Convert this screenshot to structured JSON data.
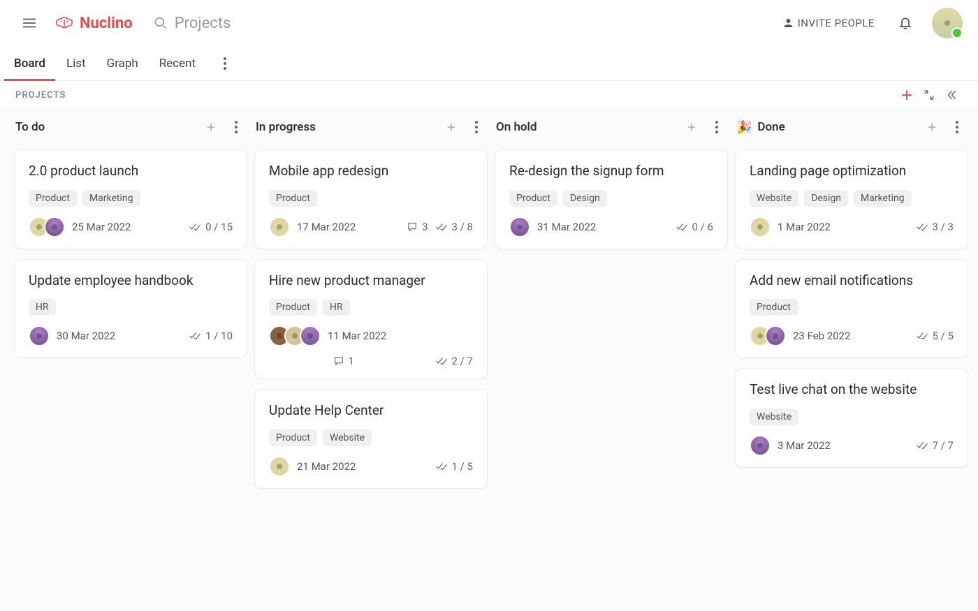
{
  "app": {
    "name": "Nuclino",
    "search_placeholder": "Projects",
    "invite_label": "INVITE PEOPLE"
  },
  "view_tabs": [
    "Board",
    "List",
    "Graph",
    "Recent"
  ],
  "active_view_tab": "Board",
  "board": {
    "title": "PROJECTS"
  },
  "columns": [
    {
      "title": "To do",
      "emoji": "",
      "cards": [
        {
          "title": "2.0 product launch",
          "tags": [
            "Product",
            "Marketing"
          ],
          "avatars": [
            "av-1",
            "av-2"
          ],
          "date": "25 Mar 2022",
          "comments": null,
          "checklist": "0 / 15"
        },
        {
          "title": "Update employee handbook",
          "tags": [
            "HR"
          ],
          "avatars": [
            "av-2"
          ],
          "date": "30 Mar 2022",
          "comments": null,
          "checklist": "1 / 10"
        }
      ]
    },
    {
      "title": "In progress",
      "emoji": "",
      "cards": [
        {
          "title": "Mobile app redesign",
          "tags": [
            "Product"
          ],
          "avatars": [
            "av-1"
          ],
          "date": "17 Mar 2022",
          "comments": "3",
          "checklist": "3 / 8"
        },
        {
          "title": "Hire new product manager",
          "tags": [
            "Product",
            "HR"
          ],
          "avatars": [
            "av-3",
            "av-4",
            "av-5"
          ],
          "date": "11 Mar 2022",
          "comments": "1",
          "checklist": "2 / 7",
          "wrap_meta": true
        },
        {
          "title": "Update Help Center",
          "tags": [
            "Product",
            "Website"
          ],
          "avatars": [
            "av-1"
          ],
          "date": "21 Mar 2022",
          "comments": null,
          "checklist": "1 / 5"
        }
      ]
    },
    {
      "title": "On hold",
      "emoji": "",
      "cards": [
        {
          "title": "Re-design the signup form",
          "tags": [
            "Product",
            "Design"
          ],
          "avatars": [
            "av-2"
          ],
          "date": "31 Mar 2022",
          "comments": null,
          "checklist": "0 / 6"
        }
      ]
    },
    {
      "title": "Done",
      "emoji": "🎉",
      "cards": [
        {
          "title": "Landing page optimization",
          "tags": [
            "Website",
            "Design",
            "Marketing"
          ],
          "avatars": [
            "av-1"
          ],
          "date": "1 Mar 2022",
          "comments": null,
          "checklist": "3 / 3"
        },
        {
          "title": "Add new email notifications",
          "tags": [
            "Product"
          ],
          "avatars": [
            "av-1",
            "av-2"
          ],
          "date": "23 Feb 2022",
          "comments": null,
          "checklist": "5 / 5"
        },
        {
          "title": "Test live chat on the website",
          "tags": [
            "Website"
          ],
          "avatars": [
            "av-2"
          ],
          "date": "3 Mar 2022",
          "comments": null,
          "checklist": "7 / 7"
        }
      ]
    }
  ]
}
